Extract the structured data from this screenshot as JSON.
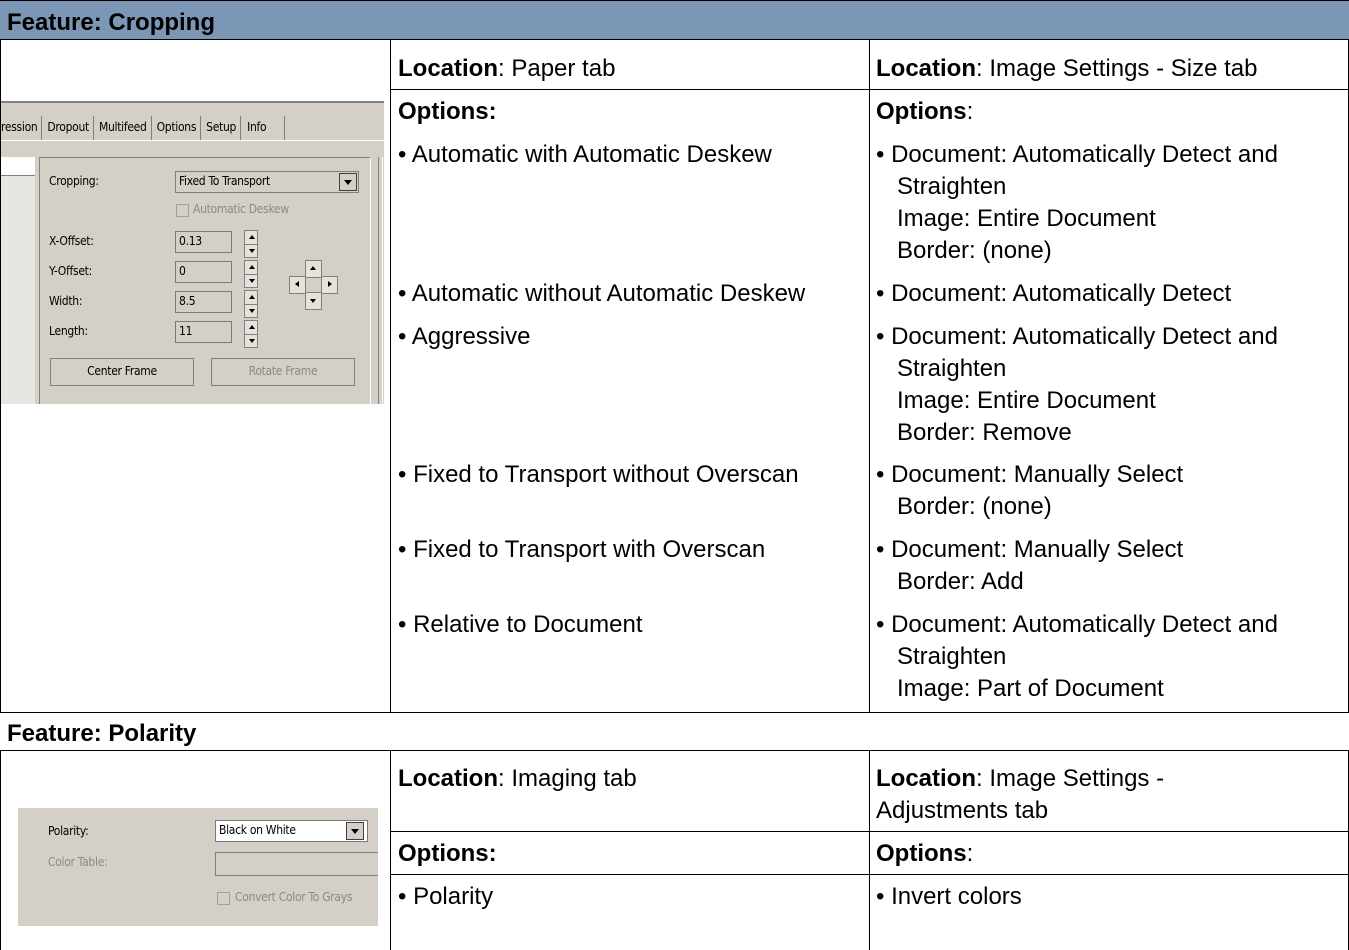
{
  "sections": [
    {
      "title": "Feature: Cropping",
      "location_left": {
        "label": "Location",
        "value": ": Paper tab"
      },
      "location_right": {
        "label": "Location",
        "value": ": Image Settings - Size tab"
      },
      "options_left": "Options:",
      "options_right_label": "Options",
      "options_right_colon": ":",
      "rows": [
        {
          "left": "• Automatic with Automatic Deskew",
          "right": [
            "• Document: Automatically Detect and",
            "Straighten",
            "Image: Entire Document",
            "Border: (none)"
          ]
        },
        {
          "left": "• Automatic without Automatic Deskew",
          "right": [
            "• Document: Automatically Detect"
          ]
        },
        {
          "left": "• Aggressive",
          "right": [
            "• Document: Automatically Detect and",
            "Straighten",
            "Image: Entire Document",
            "Border: Remove"
          ]
        },
        {
          "left": "• Fixed to Transport without Overscan",
          "right": [
            "• Document: Manually Select",
            "Border: (none)"
          ]
        },
        {
          "left": "• Fixed to Transport with Overscan",
          "right": [
            "• Document: Manually Select",
            "Border: Add"
          ]
        },
        {
          "left": "• Relative to Document",
          "right": [
            "• Document: Automatically Detect and",
            "Straighten",
            "Image: Part of Document"
          ]
        }
      ],
      "dialog": {
        "tabs": [
          "ression",
          "Dropout",
          "Multifeed",
          "Options",
          "Setup",
          "Info"
        ],
        "cropping_label": "Cropping:",
        "cropping_value": "Fixed To Transport",
        "auto_deskew": "Automatic Deskew",
        "fields": [
          {
            "label": "X-Offset:",
            "value": "0.13"
          },
          {
            "label": "Y-Offset:",
            "value": "0"
          },
          {
            "label": "Width:",
            "value": "8.5"
          },
          {
            "label": "Length:",
            "value": "11"
          }
        ],
        "center_frame": "Center Frame",
        "rotate_frame": "Rotate Frame"
      }
    },
    {
      "title": "Feature: Polarity",
      "location_left": {
        "label": "Location",
        "value": ": Imaging tab"
      },
      "location_right": {
        "label": "Location",
        "value": ": Image Settings -",
        "value2": "Adjustments tab"
      },
      "options_left": "Options:",
      "options_right_label": "Options",
      "options_right_colon": ":",
      "rows": [
        {
          "left": "• Polarity",
          "right": [
            "• Invert colors"
          ]
        }
      ],
      "dialog": {
        "polarity_label": "Polarity:",
        "polarity_value": "Black on White",
        "color_table_label": "Color Table:",
        "convert_label": "Convert Color To Grays"
      }
    }
  ]
}
